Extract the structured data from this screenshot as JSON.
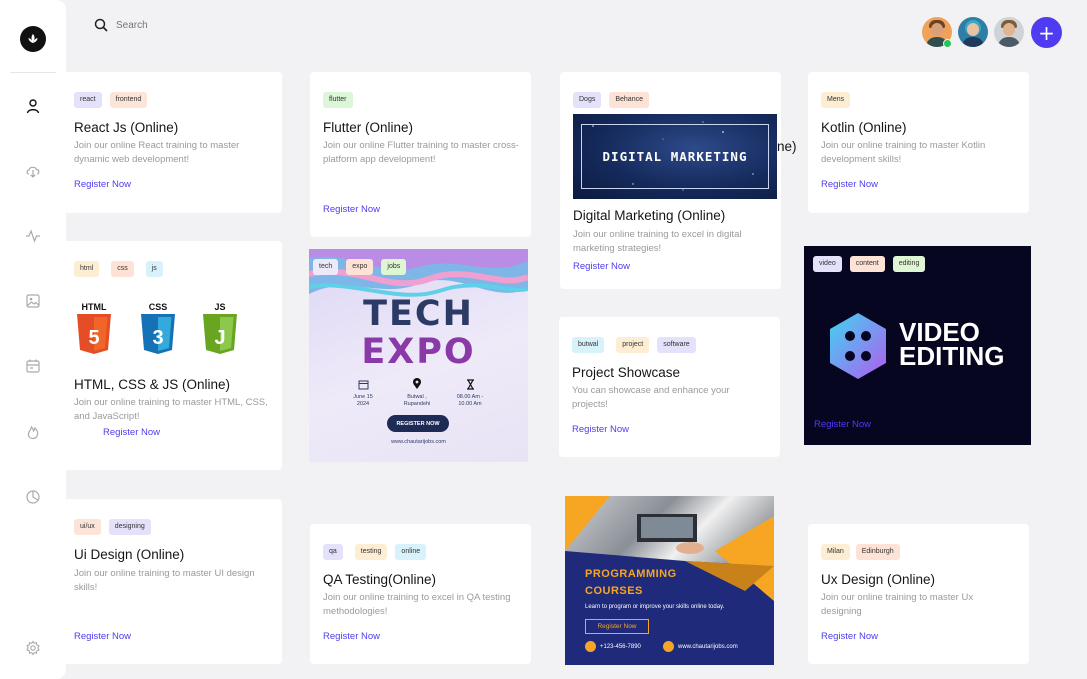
{
  "search": {
    "placeholder": "Search"
  },
  "colors": {
    "accent": "#4f3cf0",
    "online": "#22c55e"
  },
  "sidebar": {
    "items": [
      {
        "icon": "user-icon"
      },
      {
        "icon": "cloud-download-icon"
      },
      {
        "icon": "activity-icon"
      },
      {
        "icon": "image-icon"
      },
      {
        "icon": "calendar-icon"
      },
      {
        "icon": "flame-icon"
      },
      {
        "icon": "pie-chart-icon"
      },
      {
        "icon": "settings-icon"
      }
    ]
  },
  "header": {
    "add_label": "+"
  },
  "cards": {
    "react": {
      "tags": [
        "react",
        "frontend"
      ],
      "title": "React Js (Online)",
      "desc": "Join our online React training to master dynamic web development!",
      "cta": "Register Now"
    },
    "web": {
      "tags": [
        "html",
        "css",
        "js"
      ],
      "title": "HTML, CSS & JS (Online)",
      "desc": "Join our online training to master HTML, CSS, and JavaScript!",
      "cta": "Register Now",
      "logos": [
        "HTML",
        "CSS",
        "JS",
        "5",
        "3",
        "J"
      ]
    },
    "uidesign": {
      "tags": [
        "ui/ux",
        "designing"
      ],
      "title": "Ui Design (Online)",
      "desc": "Join our online training to master UI design skills!",
      "cta": "Register Now"
    },
    "flutter": {
      "tags": [
        "flutter"
      ],
      "title": "Flutter (Online)",
      "desc": "Join our online Flutter training to master cross-platform app development!",
      "cta": "Register Now"
    },
    "techexpo": {
      "tags": [
        "tech",
        "expo",
        "jobs"
      ],
      "poster_line1": "TECH",
      "poster_line2": "EXPO",
      "date": "June 15\n2024",
      "location": "Butwal ,\nRupandehi",
      "time": "08.00 Am -\n10.00 Am",
      "button": "REGISTER NOW",
      "site": "www.chautarijobs.com"
    },
    "qa": {
      "tags": [
        "qa",
        "testing",
        "online"
      ],
      "title": "QA Testing(Online)",
      "desc": "Join our online training to excel in QA testing methodologies!",
      "cta": "Register Now"
    },
    "digital": {
      "tags": [
        "Dogs",
        "Behance"
      ],
      "banner": "DIGITAL MARKETING",
      "overflow": "ne)",
      "title": "Digital Marketing (Online)",
      "desc": "Join our online training to excel in digital marketing strategies!",
      "cta": "Register Now"
    },
    "project": {
      "tags": [
        "butwal",
        "project",
        "software"
      ],
      "title": "Project Showcase",
      "desc": "You can showcase and enhance your projects!",
      "cta": "Register Now"
    },
    "programming": {
      "line1": "PROGRAMMING",
      "line2": "COURSES",
      "sub": "Learn to program or improve your skills online today.",
      "button": "Register Now",
      "phone": "+123-456-7890",
      "site": "www.chautarijobs.com"
    },
    "kotlin": {
      "tags": [
        "Mens"
      ],
      "title": "Kotlin (Online)",
      "desc": "Join our online training to master Kotlin development skills!",
      "cta": "Register Now"
    },
    "video": {
      "tags": [
        "video",
        "content",
        "editing"
      ],
      "line1": "VIDEO",
      "line2": "EDITING",
      "cta": "Register Now"
    },
    "ux": {
      "tags": [
        "Milan",
        "Edinburgh"
      ],
      "title": "Ux Design (Online)",
      "desc": "Join our online training to master Ux designing",
      "cta": "Register Now"
    }
  }
}
